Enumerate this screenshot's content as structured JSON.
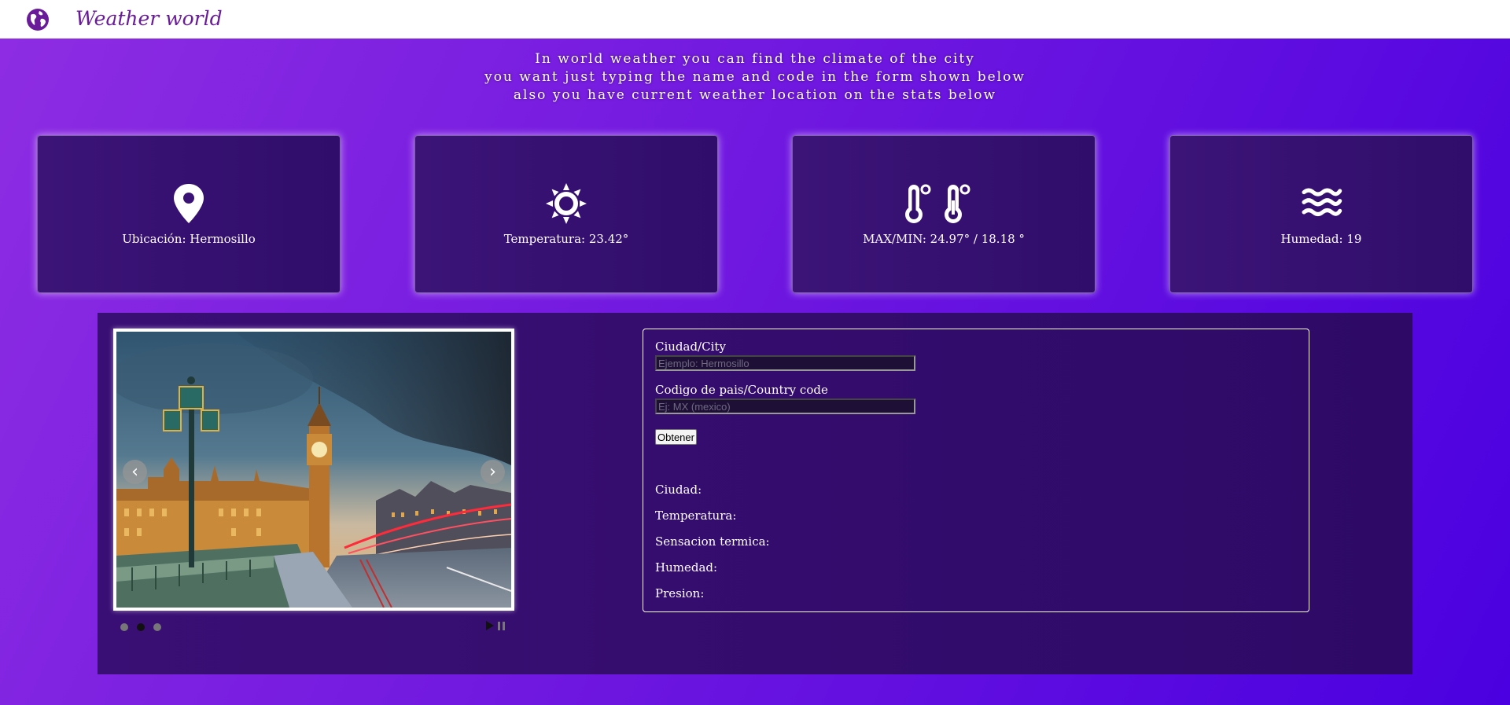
{
  "header": {
    "brand": "Weather world",
    "icon": "globe-icon",
    "brand_color": "#6a1b9a"
  },
  "intro": {
    "lines": [
      "In world weather you can find the climate of the city",
      "you want just typing the name and code in the form shown below",
      "also you have current weather location on the stats below"
    ]
  },
  "stats": [
    {
      "icon": "location-pin-icon",
      "label": "Ubicación: Hermosillo"
    },
    {
      "icon": "sun-icon",
      "label": "Temperatura: 23.42°"
    },
    {
      "icon": "thermometer-icon",
      "label": "MAX/MIN: 24.97° / 18.18 °"
    },
    {
      "icon": "water-icon",
      "label": "Humedad: 19"
    }
  ],
  "slider": {
    "image": "london-big-ben-photo",
    "prev": "‹",
    "next": "›",
    "slide_count": 3,
    "active_slide": 2
  },
  "form": {
    "city_label": "Ciudad/City",
    "city_placeholder": "Ejemplo: Hermosillo",
    "country_label": "Codigo de pais/Country code",
    "country_placeholder": "Ej: MX (mexico)",
    "submit_label": "Obtener"
  },
  "results": {
    "city": "Ciudad:",
    "temperature": "Temperatura:",
    "feels_like": "Sensacion termica:",
    "humidity": "Humedad:",
    "pressure": "Presion:"
  },
  "colors": {
    "background_start": "#8e2de2",
    "background_end": "#4a00e0",
    "card": "#36106f",
    "panel": "#340d6e"
  }
}
